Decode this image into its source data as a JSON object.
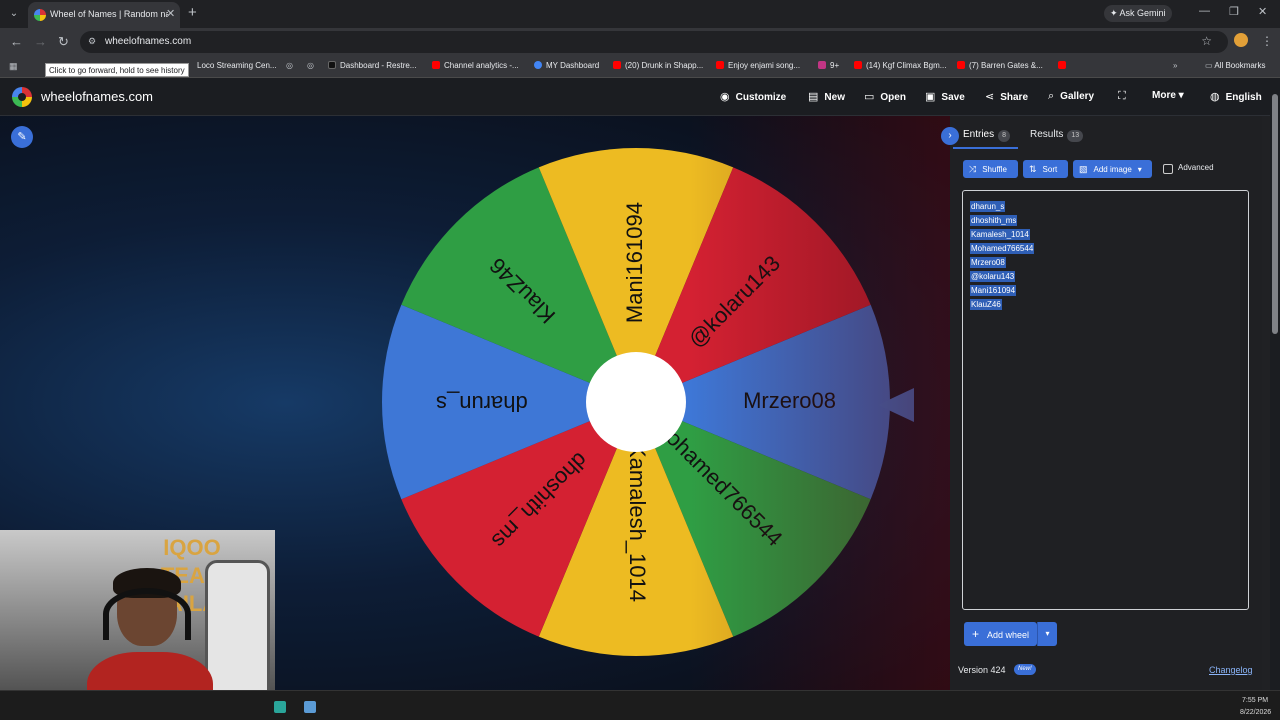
{
  "browser": {
    "tab_title": "Wheel of Names | Random nam",
    "url": "wheelofnames.com",
    "ask_gemini": "Ask Gemini",
    "tooltip": "Click to go forward, hold to see history"
  },
  "bookmarks": [
    {
      "label": "Loco Streaming Cen...",
      "color": "#e8eaed"
    },
    {
      "label": "Dashboard - Restre...",
      "color": "#e8eaed"
    },
    {
      "label": "Channel analytics -...",
      "color": "#ff0000"
    },
    {
      "label": "MY Dashboard",
      "color": "#4285f4"
    },
    {
      "label": "(20) Drunk in Shapp...",
      "color": "#ff0000"
    },
    {
      "label": "Enjoy enjami song...",
      "color": "#ff0000"
    },
    {
      "label": "9+",
      "color": "#c13584"
    },
    {
      "label": "(14) Kgf Climax Bgm...",
      "color": "#ff0000"
    },
    {
      "label": "(7) Barren Gates &...",
      "color": "#ff0000"
    }
  ],
  "all_bookmarks": "All Bookmarks",
  "app": {
    "brand": "wheelofnames.com",
    "menu": {
      "customize": "Customize",
      "new": "New",
      "open": "Open",
      "save": "Save",
      "share": "Share",
      "gallery": "Gallery",
      "more": "More",
      "language": "English"
    }
  },
  "wheel": {
    "segments": [
      {
        "label": "Mrzero08",
        "color": "#3e77d6"
      },
      {
        "label": "Mohamed766544",
        "color": "#2f9e44"
      },
      {
        "label": "Kamalesh_1014",
        "color": "#edbb22"
      },
      {
        "label": "dhoshith_ms",
        "color": "#d42132"
      },
      {
        "label": "dharun_s",
        "color": "#3e77d6"
      },
      {
        "label": "KlauZ46",
        "color": "#2f9e44"
      },
      {
        "label": "Mani161094",
        "color": "#edbb22"
      },
      {
        "label": "@kolaru143",
        "color": "#d42132"
      }
    ]
  },
  "panel": {
    "tabs": {
      "entries": "Entries",
      "entries_count": "8",
      "results": "Results",
      "results_count": "13"
    },
    "buttons": {
      "shuffle": "Shuffle",
      "sort": "Sort",
      "add_image": "Add image",
      "advanced": "Advanced"
    },
    "entries": [
      "dharun_s",
      "dhoshith_ms",
      "Kamalesh_1014",
      "Mohamed766544",
      "Mrzero08",
      "@kolaru143",
      "Mani161094",
      "KlauZ46"
    ],
    "add_wheel": "Add wheel",
    "version": "Version 424",
    "new_badge": "New!",
    "changelog": "Changelog"
  },
  "webcam": {
    "overlay": [
      "IQOO",
      "TEAM",
      "KAILAS"
    ]
  },
  "taskbar": {
    "time": "7:55 PM",
    "date": "8/22/2026"
  }
}
